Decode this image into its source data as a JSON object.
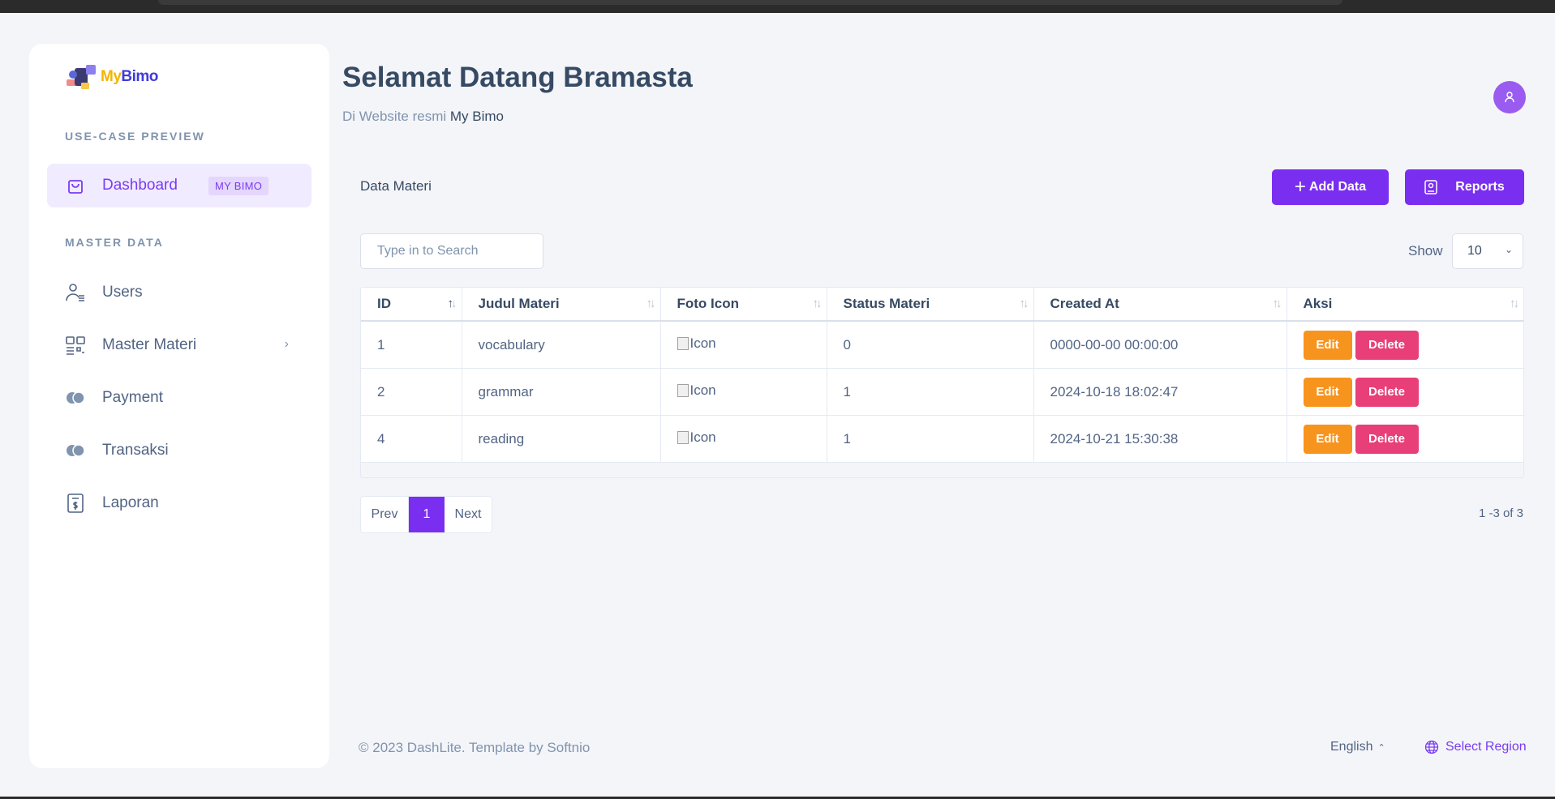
{
  "brand": {
    "my": "My",
    "bimo": "Bimo"
  },
  "sidebar": {
    "section1_title": "USE-CASE PREVIEW",
    "dashboard": {
      "label": "Dashboard",
      "badge": "MY BIMO"
    },
    "section2_title": "MASTER DATA",
    "items": [
      {
        "label": "Users",
        "icon": "users-icon"
      },
      {
        "label": "Master Materi",
        "icon": "grid-icon"
      },
      {
        "label": "Payment",
        "icon": "coins-icon"
      },
      {
        "label": "Transaksi",
        "icon": "coins-icon"
      },
      {
        "label": "Laporan",
        "icon": "report-icon"
      }
    ]
  },
  "header": {
    "title": "Selamat Datang Bramasta",
    "subtitle_prefix": "Di Website resmi",
    "subtitle_strong": "My Bimo"
  },
  "card": {
    "title": "Data Materi",
    "add_label": "Add Data",
    "reports_label": "Reports",
    "search_placeholder": "Type in to Search",
    "show_label": "Show",
    "show_value": "10"
  },
  "table": {
    "columns": [
      "ID",
      "Judul Materi",
      "Foto Icon",
      "Status Materi",
      "Created At",
      "Aksi"
    ],
    "rows": [
      {
        "id": "1",
        "judul": "vocabulary",
        "foto": "Icon",
        "status": "0",
        "created": "0000-00-00 00:00:00"
      },
      {
        "id": "2",
        "judul": "grammar",
        "foto": "Icon",
        "status": "1",
        "created": "2024-10-18 18:02:47"
      },
      {
        "id": "4",
        "judul": "reading",
        "foto": "Icon",
        "status": "1",
        "created": "2024-10-21 15:30:38"
      }
    ],
    "edit_label": "Edit",
    "delete_label": "Delete"
  },
  "pagination": {
    "prev": "Prev",
    "current": "1",
    "next": "Next",
    "info": "1 -3 of 3"
  },
  "footer": {
    "copyright": "© 2023 DashLite. Template by Softnio",
    "language": "English",
    "region": "Select Region"
  },
  "colors": {
    "accent": "#7a2ff0",
    "edit": "#f7941d",
    "delete": "#e83f79",
    "background": "#f4f5f9"
  }
}
